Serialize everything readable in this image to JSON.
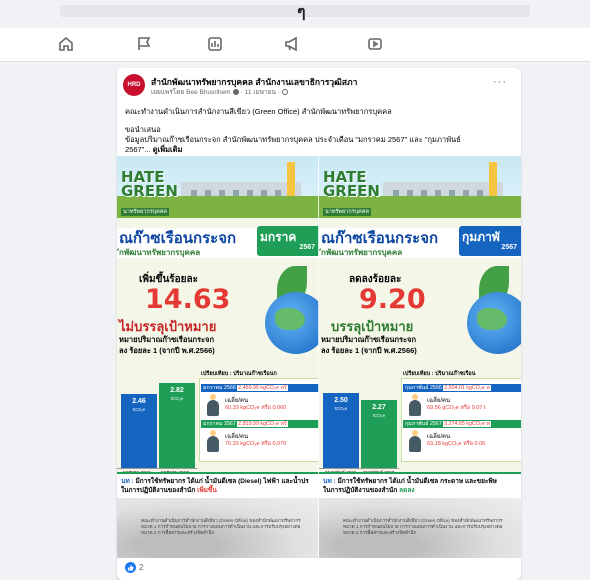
{
  "topbar": {
    "glyph": "ๆ"
  },
  "nav": {
    "icons": [
      "home-icon",
      "flag-icon",
      "video-icon",
      "megaphone-icon",
      "play-icon"
    ]
  },
  "post": {
    "page_name": "สำนักพัฒนาทรัพยากรบุคคล สำนักงานเลขาธิการวุฒิสภา",
    "avatar_text": "HRD",
    "author": "เผยแพร่โดย Bee Bhusrihem",
    "date": "11 เมษายน",
    "menu": "···",
    "line1": "คณะทำงานดำเนินการสำนักงานสีเขียว (Green Office) สำนักพัฒนาทรัพยากรบุคคล",
    "line2": "ขอนำเสนอ",
    "line3": "ข้อมูลปริมาณก๊าซเรือนกระจก สำนักพัฒนาทรัพยากรบุคคล ประจำเดือน \"มกราคม 2567\" และ \"กุมภาพันธ์",
    "line4": "2567\"...",
    "see_more": "ดูเพิ่มเติม",
    "reaction_count": "2"
  },
  "panels": [
    {
      "logo1": "HATE",
      "logo2": "GREEN",
      "logo_sub": "นาทรัพยากรบุคคล",
      "title": "ณก๊าซเรือนกระจก",
      "subtitle": "ักพัฒนาทรัพยากรบุคคล",
      "month": "มกราค",
      "year": "2567",
      "change_label": "เพิ่มขึ้นร้อยละ",
      "change_value": "14.63",
      "goal": "ไม่บรรลุเป้าหมาย",
      "target1": "หมายปริมาณก๊าซเรือนกระจก",
      "target2_a": "ลง ร้อยละ 1",
      "target2_b": " (จากปี พ.ศ.2566)",
      "compare_head": "เปรียบเทียบ : ปริมาณก๊าซเรือนก",
      "row1_label": "มกราคม 2566",
      "row1_value": "2,459.95 kgCO₂e หรื",
      "per1_label": "เฉลี่ย/คน",
      "per1_value": "60.33 kgCO₂e หรือ 0.060",
      "row2_label": "มกราคม 2567",
      "row2_value": "2,819.99 kgCO₂e หรื",
      "per2_label": "เฉลี่ย/คน",
      "per2_value": "70.33 kgCO₂e หรือ 0.070",
      "bar1_value": "2.46",
      "bar2_value": "2.82",
      "bar_unit": "tCO₂e",
      "bar1_x": "มกราคม 2566",
      "bar2_x": "มกราคม 2567",
      "footer_a": "นท : ",
      "footer_b": "มีการใช้ทรัพยากร ได้แก่ น้ำมันดีเซล (Diesel) ไฟฟ้า และน้ำปร",
      "footer_c": "ในการปฏิบัติงานของสำนัก ",
      "footer_d": "เพิ่มขึ้น",
      "note1": "คณะทำงานดำเนินการสำนักงานสีเขียว (Green Office) ของสำนักพัฒนาทรัพยากร",
      "note2": "หมวด 1 การกำหนดนโยบาย การวางแผนการดำเนินงาน และการปรับปรุงอย่างต่อ",
      "note3": "หมวด 2 การสื่อสารและสร้างจิตสำนึก"
    },
    {
      "logo1": "HATE",
      "logo2": "GREEN",
      "logo_sub": "นาทรัพยากรบุคคล",
      "title": "ณก๊าซเรือนกระจก",
      "subtitle": "ักพัฒนาทรัพยากรบุคคล",
      "month": "กุมภาพั",
      "year": "2567",
      "change_label": "ลดลงร้อยละ",
      "change_value": "9.20",
      "goal": "บรรลุเป้าหมาย",
      "target1": "หมายปริมาณก๊าซเรือนกระจก",
      "target2_a": "ลง ร้อยละ 1",
      "target2_b": " (จากปี พ.ศ.2566)",
      "compare_head": "เปรียบเทียบ : ปริมาณก๊าซเรือน",
      "row1_label": "กุมภาพันธ์ 2566",
      "row1_value": "2,504.01 kgCO₂e ห",
      "per1_label": "เฉลี่ย/คน",
      "per1_value": "69.56 gCO₂e หรือ 0.07 t",
      "row2_label": "กุมภาพันธ์ 2567",
      "row2_value": "2,274.65 kgCO₂e ห",
      "per2_label": "เฉลี่ย/คน",
      "per2_value": "63.18 kgCO₂e หรือ 0.06",
      "bar1_value": "2.50",
      "bar2_value": "2.27",
      "bar_unit": "tCO₂e",
      "bar1_x": "กุมภาพันธ์ 2566",
      "bar2_x": "กุมภาพันธ์ 2567",
      "footer_a": "นท : ",
      "footer_b": "มีการใช้ทรัพยากร ได้แก่ น้ำมันดีเซล กระดาษ และขยะพิษ",
      "footer_c": "ในการปฏิบัติงานของสำนัก ",
      "footer_d": "ลดลง",
      "note1": "คณะทำงานดำเนินการสำนักงานสีเขียว (Green Office) ของสำนักพัฒนาทรัพยากร",
      "note2": "หมวด 1 การกำหนดนโยบาย การวางแผนการดำเนินงาน และการปรับปรุงอย่างต่อ",
      "note3": "หมวด 2 การสื่อสารและสร้างจิตสำนึก"
    }
  ],
  "colors": {
    "increase": "#e53935",
    "decrease": "#1e9e57",
    "brand_blue": "#1877f2"
  }
}
